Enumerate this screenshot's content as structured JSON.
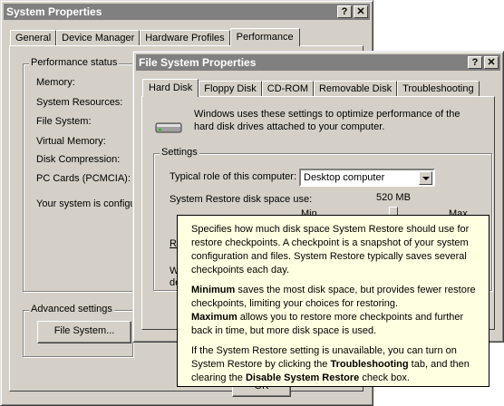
{
  "system_properties": {
    "title": "System Properties",
    "help_btn": "?",
    "close_btn": "✕",
    "tabs": [
      "General",
      "Device Manager",
      "Hardware Profiles",
      "Performance"
    ],
    "performance_status_label": "Performance status",
    "status_labels": [
      "Memory:",
      "System Resources:",
      "File System:",
      "Virtual Memory:",
      "Disk Compression:",
      "PC Cards (PCMCIA):"
    ],
    "config_text": "Your system is configu",
    "advanced_settings_label": "Advanced settings",
    "file_system_button": "File System...",
    "ok_button": "OK"
  },
  "file_system_properties": {
    "title": "File System Properties",
    "help_btn": "?",
    "close_btn": "✕",
    "tabs": [
      "Hard Disk",
      "Floppy Disk",
      "CD-ROM",
      "Removable Disk",
      "Troubleshooting"
    ],
    "intro_text": "Windows uses these settings to optimize performance of the hard disk drives attached to your computer.",
    "settings_label": "Settings",
    "typical_role_label": "Typical role of this computer:",
    "typical_role_value": "Desktop computer",
    "restore_space_label": "System Restore disk space use:",
    "restore_space_value": "520 MB",
    "min_label": "Min",
    "max_label": "Max",
    "partial_letter_r": "R",
    "partial_letter_w": "W",
    "partial_letter_de": "de"
  },
  "tooltip": {
    "p1": "Specifies how much disk space System Restore should use for restore checkpoints. A checkpoint is a snapshot of your system configuration and files. System Restore typically saves several checkpoints each day.",
    "minimum_bold": "Minimum",
    "minimum_text": " saves the most disk space, but provides fewer restore checkpoints, limiting your choices for restoring.",
    "maximum_bold": "Maximum",
    "maximum_text": " allows you to restore more checkpoints and further back in time, but more disk space is used.",
    "p3_a": "If the System Restore setting is unavailable, you can turn on System Restore by clicking the ",
    "p3_troubleshooting": "Troubleshooting",
    "p3_b": " tab, and then clearing the ",
    "p3_disable": "Disable System Restore",
    "p3_c": " check box."
  }
}
